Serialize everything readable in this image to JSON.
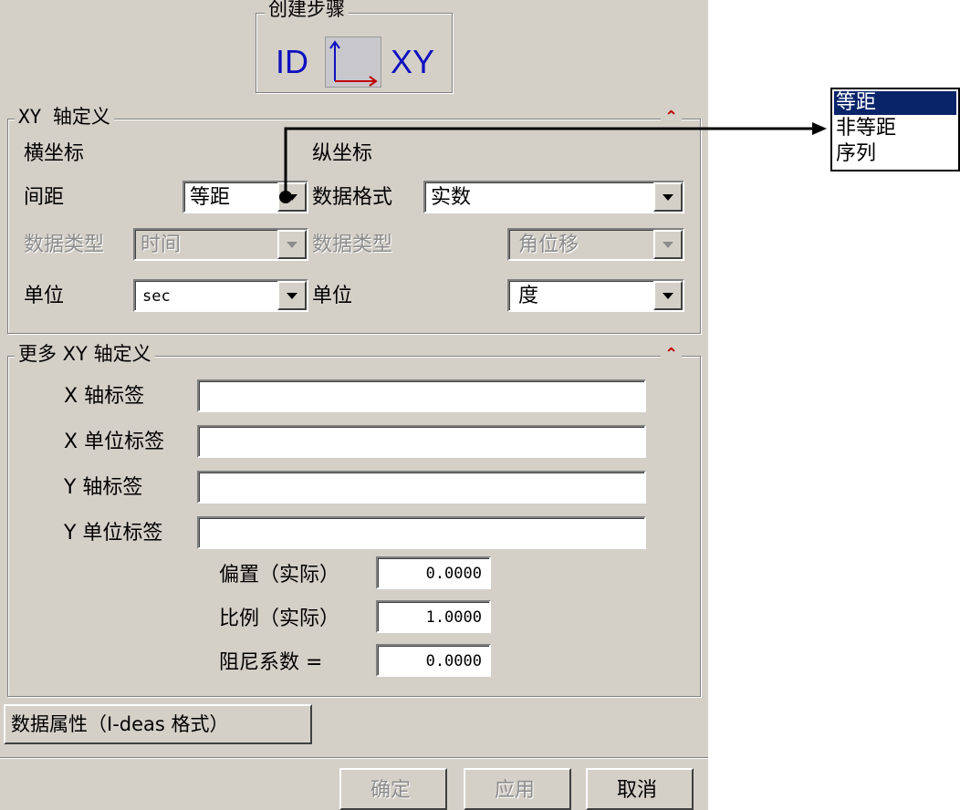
{
  "create_step": {
    "title": "创建步骤",
    "left_label": "ID",
    "right_label": "XY"
  },
  "xy_axis": {
    "title": "XY 轴定义",
    "x_header": "横坐标",
    "y_header": "纵坐标",
    "spacing_label": "间距",
    "spacing_value": "等距",
    "data_format_label": "数据格式",
    "data_format_value": "实数",
    "x_data_type_label": "数据类型",
    "x_data_type_value": "时间",
    "y_data_type_label": "数据类型",
    "y_data_type_value": "角位移",
    "x_unit_label": "单位",
    "x_unit_value": "sec",
    "y_unit_label": "单位",
    "y_unit_value": "度"
  },
  "more_xy": {
    "title": "更多 XY 轴定义",
    "x_axis_label": "X 轴标签",
    "x_axis_value": "",
    "x_unit_label": "X 单位标签",
    "x_unit_value": "",
    "y_axis_label": "Y 轴标签",
    "y_axis_value": "",
    "y_unit_label": "Y 单位标签",
    "y_unit_value": "",
    "offset_label": "偏置（实际）",
    "offset_value": "0.0000",
    "scale_label": "比例（实际）",
    "scale_value": "1.0000",
    "damping_label": "阻尼系数 =",
    "damping_value": "0.0000"
  },
  "data_attr_button": "数据属性（I-deas 格式）",
  "footer": {
    "ok": "确定",
    "apply": "应用",
    "cancel": "取消"
  },
  "spacing_options": [
    "等距",
    "非等距",
    "序列"
  ],
  "colors": {
    "dialog_bg": "#d4d0c8",
    "selection": "#0a246a",
    "accent_red": "#c00000",
    "xy_blue": "#1010c0"
  }
}
